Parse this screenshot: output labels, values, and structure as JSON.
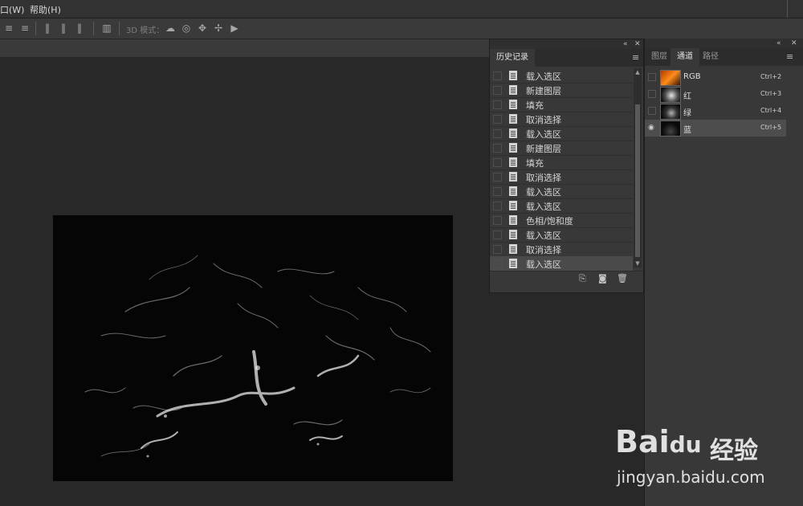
{
  "menu": {
    "window": "口(W)",
    "help": "帮助(H)"
  },
  "options_bar": {
    "mode_label": "3D 模式："
  },
  "history_panel": {
    "tab_label": "历史记录",
    "items": [
      {
        "label": "载入选区"
      },
      {
        "label": "新建图层"
      },
      {
        "label": "填充"
      },
      {
        "label": "取消选择"
      },
      {
        "label": "载入选区"
      },
      {
        "label": "新建图层"
      },
      {
        "label": "填充"
      },
      {
        "label": "取消选择"
      },
      {
        "label": "载入选区"
      },
      {
        "label": "载入选区"
      },
      {
        "label": "色相/饱和度"
      },
      {
        "label": "载入选区"
      },
      {
        "label": "取消选择"
      },
      {
        "label": "载入选区",
        "selected": true
      }
    ]
  },
  "channels_panel": {
    "tabs": [
      {
        "label": "图层"
      },
      {
        "label": "通道",
        "active": true
      },
      {
        "label": "路径"
      }
    ],
    "channels": [
      {
        "name": "RGB",
        "shortcut": "Ctrl+2",
        "visible": false,
        "selected": false,
        "thumb": "rgb-thumbnail"
      },
      {
        "name": "红",
        "shortcut": "Ctrl+3",
        "visible": false,
        "selected": false,
        "thumb": "red-channel-thumbnail"
      },
      {
        "name": "绿",
        "shortcut": "Ctrl+4",
        "visible": false,
        "selected": false,
        "thumb": "green-channel-thumbnail"
      },
      {
        "name": "蓝",
        "shortcut": "Ctrl+5",
        "visible": true,
        "selected": true,
        "thumb": "blue-channel-thumbnail"
      }
    ]
  },
  "watermark": {
    "brand_a": "Bai",
    "brand_b": "经验",
    "brand_paw": "du",
    "url": "jingyan.baidu.com"
  },
  "colors": {
    "workspace": "#282828",
    "panel": "#383838",
    "selected_row": "#4a4a4a"
  }
}
